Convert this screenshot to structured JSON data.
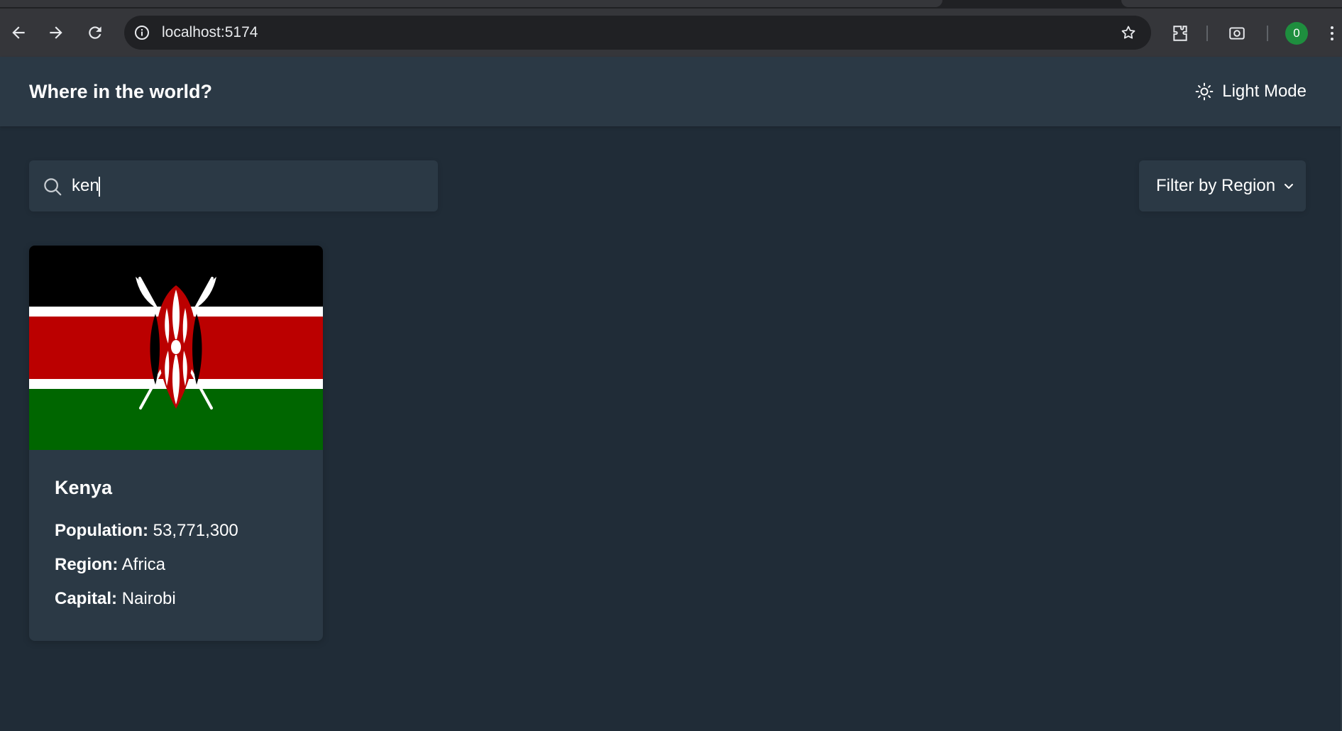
{
  "browser": {
    "url": "localhost:5174",
    "profile_initial": "0"
  },
  "header": {
    "title": "Where in the world?",
    "theme_toggle_label": "Light Mode"
  },
  "search": {
    "value": "ken",
    "placeholder": "Search for a country..."
  },
  "filter": {
    "label": "Filter by Region"
  },
  "countries": [
    {
      "name": "Kenya",
      "flag": "kenya-flag",
      "population_label": "Population:",
      "population": "53,771,300",
      "region_label": "Region:",
      "region": "Africa",
      "capital_label": "Capital:",
      "capital": "Nairobi"
    }
  ],
  "colors": {
    "background": "#202c37",
    "surface": "#2b3945",
    "text": "#ffffff"
  }
}
